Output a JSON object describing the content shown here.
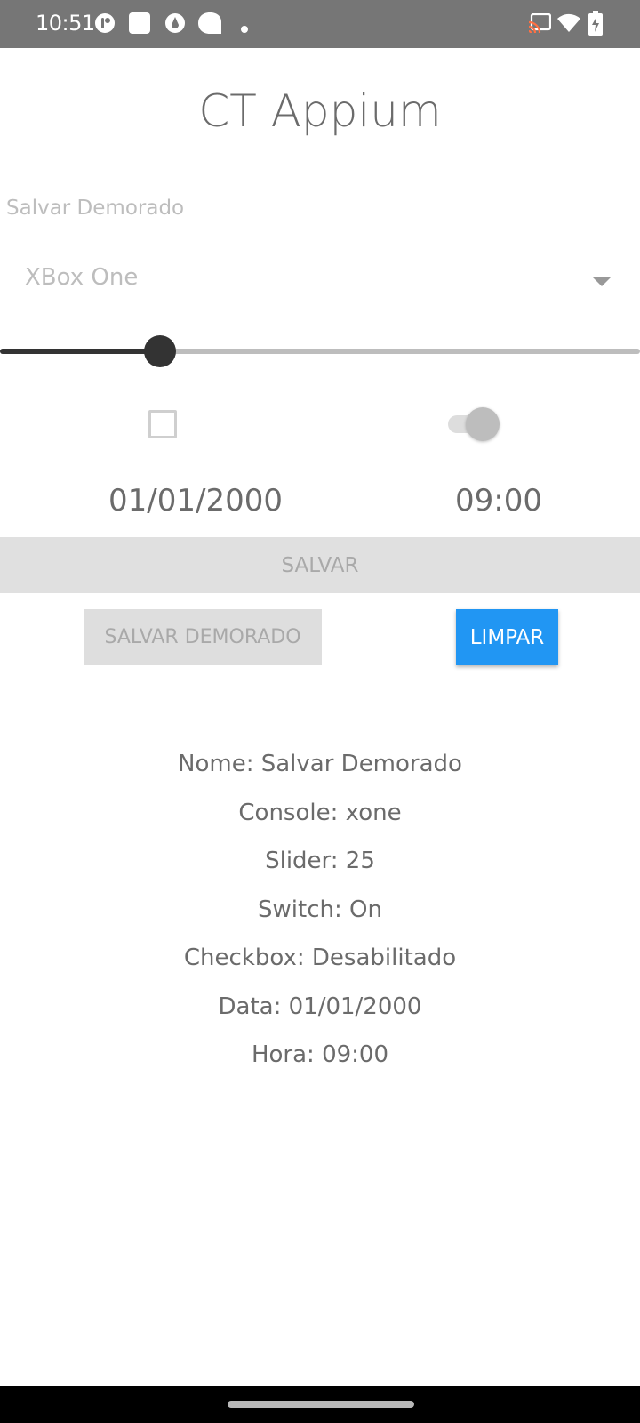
{
  "status_bar": {
    "time": "10:51",
    "left_icons": [
      "notification-app-icon",
      "square-app-icon",
      "drop-app-icon",
      "chat-bubble-icon",
      "dot-icon"
    ],
    "right_icons": [
      "cast-icon",
      "wifi-icon",
      "battery-charging-icon"
    ]
  },
  "app": {
    "title": "CT Appium"
  },
  "form": {
    "name_value": "Salvar Demorado",
    "console_selected": "XBox One",
    "slider_value": 25,
    "slider_max": 100,
    "checkbox_checked": false,
    "switch_on": true,
    "date": "01/01/2000",
    "time": "09:00"
  },
  "buttons": {
    "save": "SALVAR",
    "save_delayed": "SALVAR DEMORADO",
    "clear": "LIMPAR"
  },
  "results": [
    "Nome: Salvar Demorado",
    "Console: xone",
    "Slider: 25",
    "Switch: On",
    "Checkbox: Desabilitado",
    "Data: 01/01/2000",
    "Hora: 09:00"
  ],
  "colors": {
    "status_bar": "#767676",
    "primary": "#2196f3",
    "disabled_button": "#e0e0e0",
    "text": "#6b6b6b",
    "slider": "#333333"
  }
}
